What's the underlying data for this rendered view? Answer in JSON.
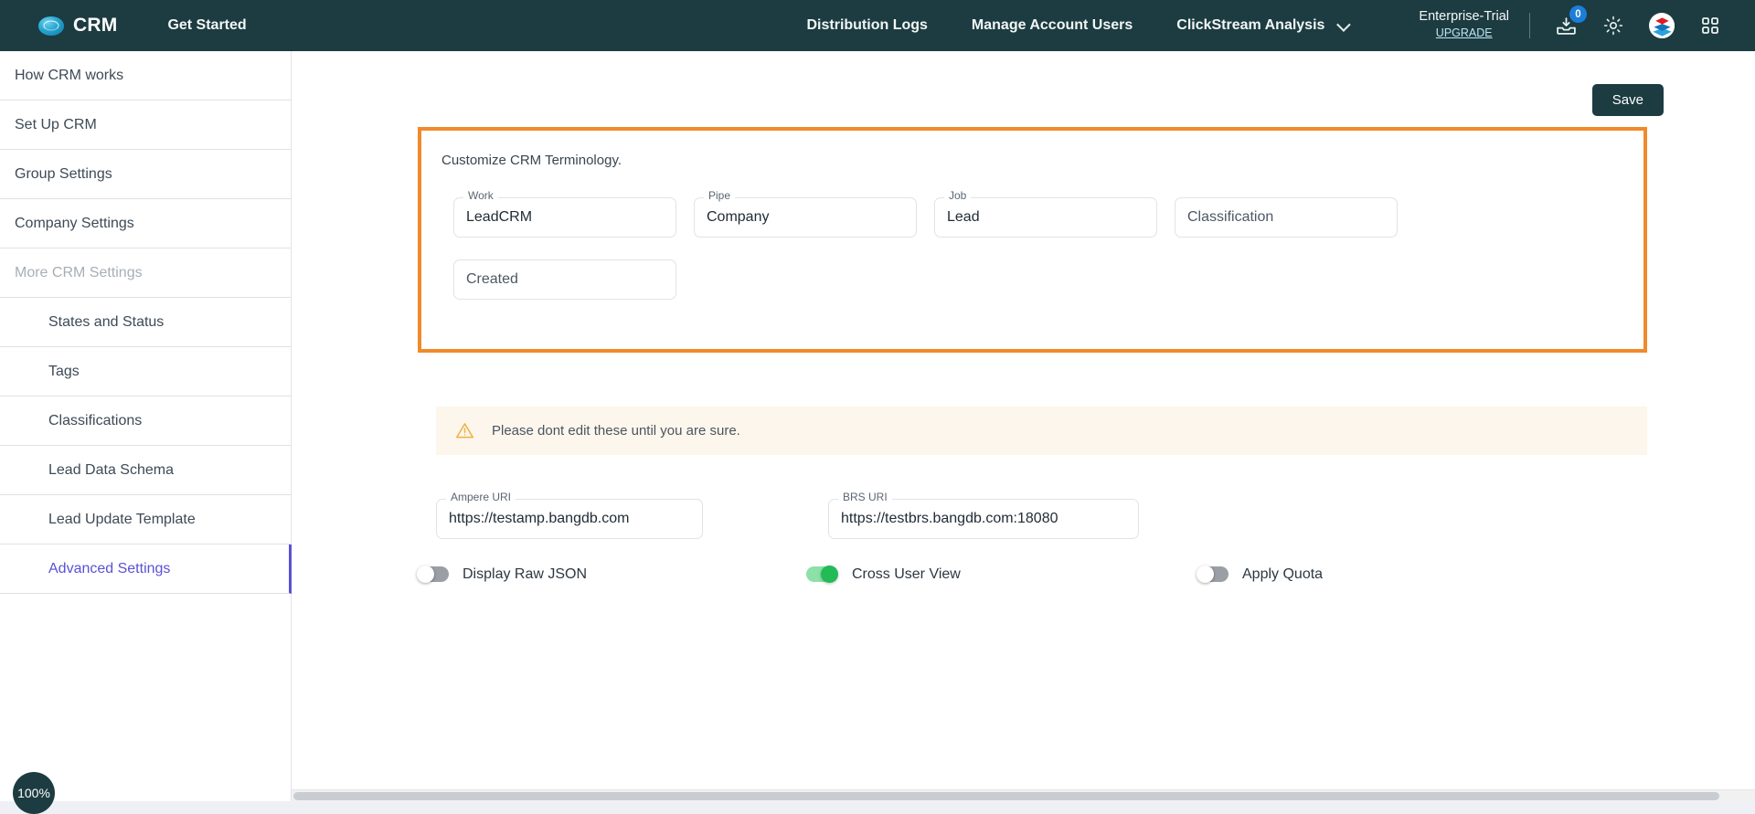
{
  "navbar": {
    "brand": "CRM",
    "brand_logo_icon": "bangdb-eye-logo-icon",
    "get_started": "Get Started",
    "links": [
      "Distribution Logs",
      "Manage Account Users"
    ],
    "dropdown_label": "ClickStream Analysis",
    "dropdown_icon": "chevron-down-icon",
    "plan_name": "Enterprise-Trial",
    "plan_upgrade": "UPGRADE",
    "icons": {
      "inbox_icon": "inbox-download-icon",
      "inbox_badge": "0",
      "gear_icon": "gear-icon",
      "product_logo_icon": "bangdb-cube-logo-icon",
      "apps_icon": "apps-grid-icon"
    },
    "background": "#1c3c41"
  },
  "sidebar": {
    "items": [
      {
        "label": "How CRM works",
        "state": "normal",
        "level": "top"
      },
      {
        "label": "Set Up CRM",
        "state": "normal",
        "level": "top"
      },
      {
        "label": "Group Settings",
        "state": "normal",
        "level": "top"
      },
      {
        "label": "Company Settings",
        "state": "normal",
        "level": "top"
      },
      {
        "label": "More CRM Settings",
        "state": "muted",
        "level": "top"
      },
      {
        "label": "States and Status",
        "state": "normal",
        "level": "sub"
      },
      {
        "label": "Tags",
        "state": "normal",
        "level": "sub"
      },
      {
        "label": "Classifications",
        "state": "normal",
        "level": "sub"
      },
      {
        "label": "Lead Data Schema",
        "state": "normal",
        "level": "sub"
      },
      {
        "label": "Lead Update Template",
        "state": "normal",
        "level": "sub"
      },
      {
        "label": "Advanced Settings",
        "state": "active",
        "level": "sub"
      }
    ],
    "active_color": "#5a51d6"
  },
  "main": {
    "save_label": "Save",
    "terminology": {
      "caption": "Customize CRM Terminology.",
      "highlight_color": "#f08a2a",
      "fields": [
        {
          "label": "Work",
          "value": "LeadCRM",
          "placeholder": ""
        },
        {
          "label": "Pipe",
          "value": "Company",
          "placeholder": ""
        },
        {
          "label": "Job",
          "value": "Lead",
          "placeholder": ""
        },
        {
          "label": "",
          "value": "",
          "placeholder": "Classification"
        },
        {
          "label": "",
          "value": "",
          "placeholder": "Created"
        }
      ]
    },
    "alert": {
      "icon": "warning-triangle-icon",
      "text": "Please dont edit these until you are sure.",
      "background": "#fdf6ec",
      "icon_color": "#edb141"
    },
    "uri_fields": [
      {
        "label": "Ampere URI",
        "value": "https://testamp.bangdb.com"
      },
      {
        "label": "BRS URI",
        "value": "https://testbrs.bangdb.com:18080"
      }
    ],
    "toggles": [
      {
        "label": "Display Raw JSON",
        "on": false
      },
      {
        "label": "Cross User View",
        "on": true
      },
      {
        "label": "Apply Quota",
        "on": false
      }
    ],
    "toggle_on_color": "#22bb55"
  },
  "zoom_badge": {
    "label": "100%"
  }
}
